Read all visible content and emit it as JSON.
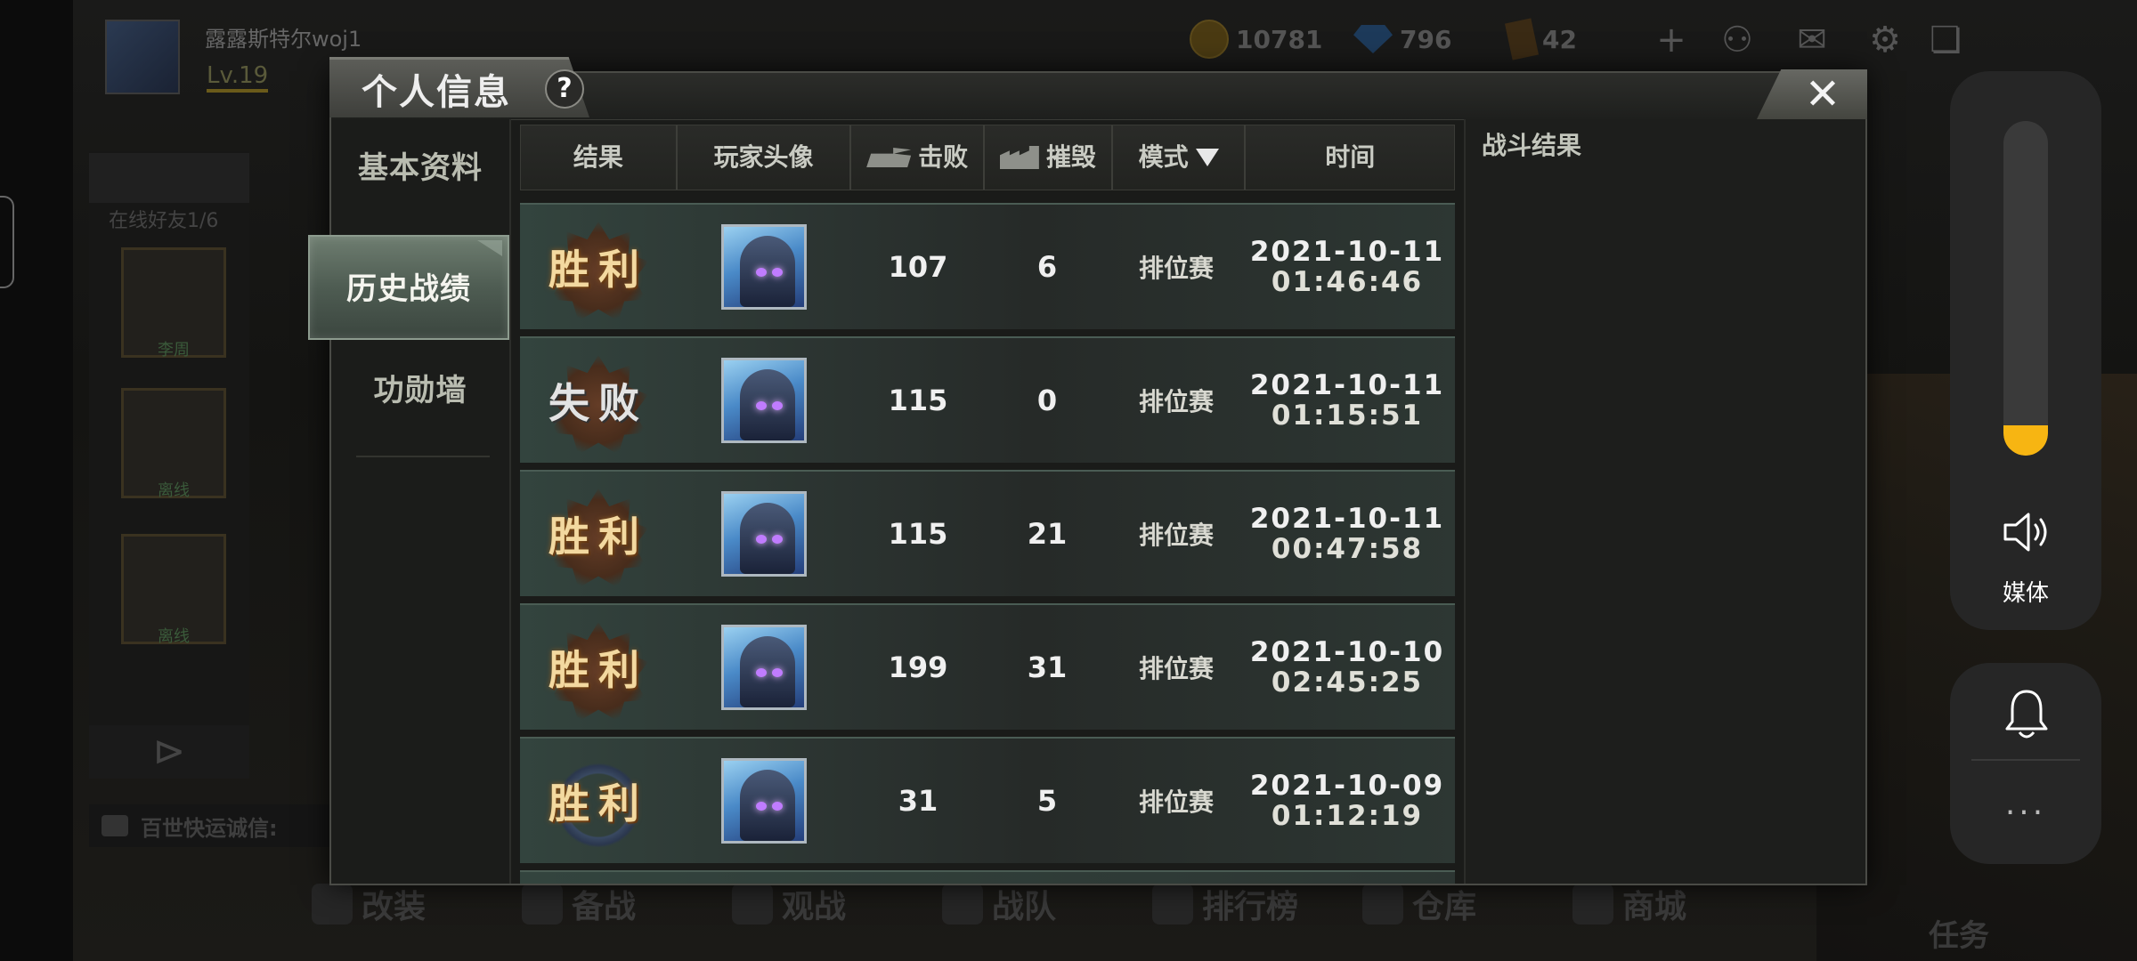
{
  "background": {
    "player_name": "露露斯特尔woj1",
    "level": "Lv.19",
    "gold": "10781",
    "diamonds": "796",
    "cards": "42",
    "online_friends": "在线好友1/6",
    "friends": [
      "李周",
      "离线",
      "离线"
    ],
    "chat_text": "百世快运诚信:",
    "nav": [
      "改装",
      "备战",
      "观战",
      "战队",
      "排行榜",
      "仓库",
      "商城"
    ],
    "task_label": "任务"
  },
  "dialog": {
    "title": "个人信息",
    "help": "?",
    "close": "✕",
    "side_nav": [
      "基本资料",
      "历史战绩",
      "功勋墙"
    ],
    "active_tab": "历史战绩",
    "columns": {
      "result": "结果",
      "avatar": "玩家头像",
      "kills": "击败",
      "destroy": "摧毁",
      "mode": "模式",
      "time": "时间"
    },
    "rows": [
      {
        "result": "胜利",
        "outcome": "win",
        "kills": "107",
        "destroy": "6",
        "mode": "排位赛",
        "date": "2021-10-11",
        "time": "01:46:46"
      },
      {
        "result": "失败",
        "outcome": "lose",
        "kills": "115",
        "destroy": "0",
        "mode": "排位赛",
        "date": "2021-10-11",
        "time": "01:15:51"
      },
      {
        "result": "胜利",
        "outcome": "win",
        "kills": "115",
        "destroy": "21",
        "mode": "排位赛",
        "date": "2021-10-11",
        "time": "00:47:58"
      },
      {
        "result": "胜利",
        "outcome": "win",
        "kills": "199",
        "destroy": "31",
        "mode": "排位赛",
        "date": "2021-10-10",
        "time": "02:45:25"
      },
      {
        "result": "胜利",
        "outcome": "win",
        "kills": "31",
        "destroy": "5",
        "mode": "排位赛",
        "date": "2021-10-09",
        "time": "01:12:19"
      }
    ],
    "detail_title": "战斗结果"
  },
  "system": {
    "volume_label": "媒体",
    "volume_level": 0.09,
    "accent": "#f7b512",
    "more": "···"
  }
}
